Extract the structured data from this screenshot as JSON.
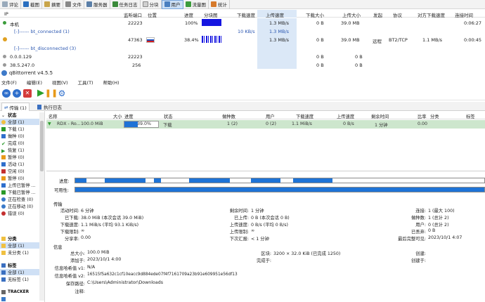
{
  "toolbar": {
    "items": [
      "评论",
      "截图",
      "摘要",
      "文件",
      "服务器",
      "任务日志",
      "分块",
      "用户",
      "流量图",
      "统计"
    ],
    "selected": "用户"
  },
  "connections": {
    "headers": [
      "IP",
      "监听端口",
      "位置",
      "进度",
      "分块图",
      "下载速度",
      "上传速度",
      "下载大小",
      "上传大小",
      "发起",
      "协议",
      "对方下载速度",
      "连接时间"
    ],
    "rows": [
      {
        "ip": "本机",
        "port": "22223",
        "flag": "",
        "progress": "100%",
        "bar": 1.0,
        "down": "",
        "up": "1.3 MB/s",
        "dsize": "0 B",
        "usize": "39.0 MB",
        "init": "",
        "proto": "",
        "peer": "",
        "time": "0:06:27"
      },
      {
        "ip": "[-]------ bt_connected (1)",
        "port": "",
        "flag": "",
        "progress": "",
        "bar": null,
        "down": "10 KB/s",
        "up": "1.3 MB/s",
        "dsize": "",
        "usize": "",
        "init": "",
        "proto": "",
        "peer": "",
        "time": ""
      },
      {
        "ip": "",
        "port": "47363",
        "flag": "ru",
        "progress": "38.4%",
        "bar": 0.384,
        "down": "",
        "up": "1.3 MB/s",
        "dsize": "0 B",
        "usize": "39.0 MB",
        "init": "远程",
        "proto": "BT2/TCP",
        "peer": "1.1 MB/s",
        "time": "0:00:45"
      },
      {
        "ip": "[-]------ bt_disconnected (3)",
        "port": "",
        "flag": "",
        "progress": "",
        "bar": null,
        "down": "",
        "up": "",
        "dsize": "",
        "usize": "",
        "init": "",
        "proto": "",
        "peer": "",
        "time": ""
      },
      {
        "ip": "0.0.0.129",
        "port": "22223",
        "flag": "",
        "progress": "",
        "bar": null,
        "down": "",
        "up": "",
        "dsize": "0 B",
        "usize": "0 B",
        "init": "",
        "proto": "",
        "peer": "",
        "time": ""
      },
      {
        "ip": "38.5.247.0",
        "port": "256",
        "flag": "",
        "progress": "",
        "bar": null,
        "down": "",
        "up": "",
        "dsize": "0 B",
        "usize": "0 B",
        "init": "",
        "proto": "",
        "peer": "",
        "time": ""
      }
    ]
  },
  "qbit": {
    "title": "qBittorrent v4.5.5",
    "menu": [
      "文件(F)",
      "编辑(E)",
      "视图(V)",
      "工具(T)",
      "帮助(H)"
    ],
    "tabs": [
      "传输 (1)",
      "执行日志"
    ]
  },
  "sidebar": {
    "status_header": "状态",
    "status": [
      "全部 (1)",
      "下载 (1)",
      "做种 (0)",
      "完成 (0)",
      "恢复 (1)",
      "暂停 (0)",
      "活动 (1)",
      "空闲 (0)",
      "暂停 (0)",
      "上传已暂停 ...",
      "下载已暂停 ...",
      "正在检查 (0)",
      "正在移动 (0)",
      "错误 (0)"
    ],
    "category_header": "分类",
    "categories": [
      "全部 (1)",
      "未分类 (1)"
    ],
    "tag_header": "标签",
    "tags": [
      "全部 (1)",
      "无标签 (1)"
    ],
    "tracker_header": "TRACKER"
  },
  "torrents": {
    "headers": [
      "名称",
      "大小",
      "进度",
      "状态",
      "做种数",
      "用户",
      "下载速度",
      "上传速度",
      "剩余时间",
      "比率",
      "分类",
      "标签"
    ],
    "row": {
      "name": "RDX - Ro...",
      "size": "100.0 MiB",
      "progress": "39.0%",
      "progress_value": 0.39,
      "status": "下载",
      "seeds": "1 (2)",
      "peers": "0 (2)",
      "down": "1.1 MiB/s",
      "up": "0 B/s",
      "eta": "1 分钟",
      "ratio": "0.00"
    }
  },
  "pieces": {
    "progress_label": "进度:",
    "avail_label": "可用性:"
  },
  "transfer": {
    "title": "传输",
    "active_time_label": "活动时间:",
    "active_time": "6 分钟",
    "downloaded_label": "已下载:",
    "downloaded": "38.0 MiB (本次会话 39.0 MiB)",
    "dl_speed_label": "下载速度:",
    "dl_speed": "1.1 MiB/s (平均 93.1 KiB/s)",
    "dl_limit_label": "下载限制:",
    "dl_limit": "∞",
    "share_ratio_label": "分享率:",
    "share_ratio": "0.00",
    "eta_label": "剩余时间:",
    "eta": "1 分钟",
    "uploaded_label": "已上传:",
    "uploaded": "0 B (本次会话 0 B)",
    "ul_speed_label": "上传速度:",
    "ul_speed": "0 B/s (平均 0 B/s)",
    "ul_limit_label": "上传限制:",
    "ul_limit": "∞",
    "reannounce_label": "下次汇报:",
    "reannounce": "< 1 分钟",
    "connections_label": "连接:",
    "connections": "1 (最大 100)",
    "seeds_label": "做种数:",
    "seeds": "1 (总计 2)",
    "peers_label": "用户:",
    "peers": "0 (总计 2)",
    "wasted_label": "已丢弃:",
    "wasted": "0 B",
    "last_complete_label": "最后完整可见:",
    "last_complete": "2023/10/1 4:07"
  },
  "information": {
    "title": "信息",
    "total_size_label": "总大小:",
    "total_size": "100.0 MiB",
    "added_label": "添加于:",
    "added": "2023/10/1 4:00",
    "hash_v1_label": "信息哈希值 v1:",
    "hash_v1": "N/A",
    "hash_v2_label": "信息哈希值 v2:",
    "hash_v2": "16515f5a632c1cf10eacc9d884ede07f4f7161709a23b91e609951e56df13",
    "save_path_label": "保存路径:",
    "save_path": "C:\\Users\\Administrator\\Downloads",
    "comment_label": "注释:",
    "pieces_label": "区块:",
    "pieces": "3200 × 32.0 KiB (已完成 1250)",
    "completed_on_label": "完成于:",
    "created_label": "创建:",
    "created_by_label": "创建于:"
  },
  "colors": {
    "accent": "#1e73d6",
    "row_green": "#cde6cd",
    "selected_col": "#dbe8f7"
  }
}
